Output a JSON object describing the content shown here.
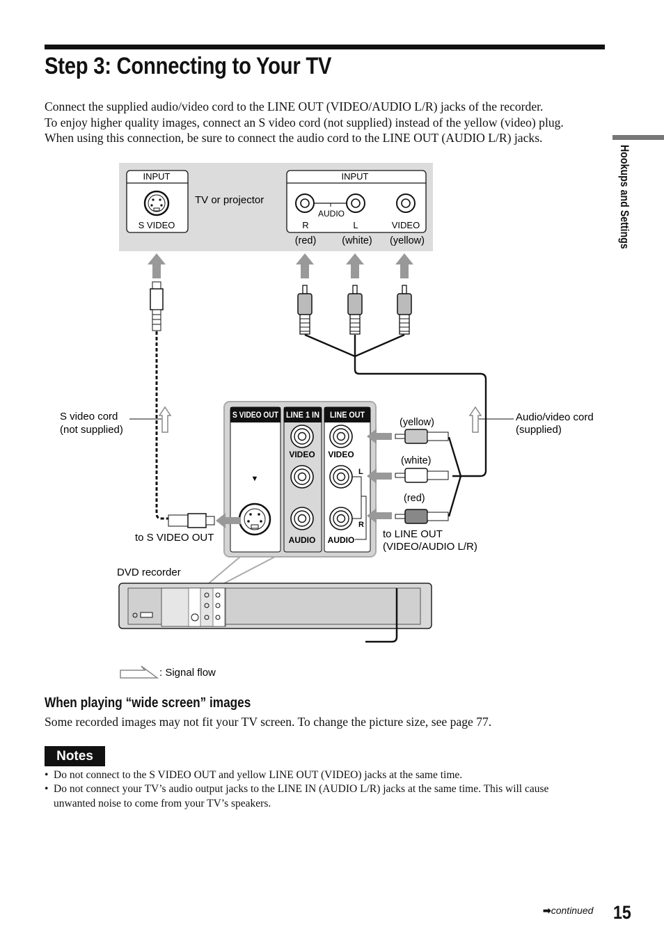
{
  "page": {
    "title": "Step 3: Connecting to Your TV",
    "intro": [
      "Connect the supplied audio/video cord to the LINE OUT (VIDEO/AUDIO L/R) jacks of the recorder.",
      "To enjoy higher quality images, connect an S video cord (not supplied) instead of the yellow (video) plug.",
      "When using this connection, be sure to connect the audio cord to the LINE OUT (AUDIO L/R) jacks."
    ],
    "side_tab": "Hookups and Settings",
    "page_number": "15",
    "continued": "continued"
  },
  "diagram": {
    "tv": {
      "label": "TV or projector",
      "svideo_box_header": "INPUT",
      "svideo_box_label": "S VIDEO",
      "av_box_header": "INPUT",
      "audio_label": "AUDIO",
      "jack_r": "R",
      "jack_l": "L",
      "jack_video": "VIDEO",
      "color_red": "(red)",
      "color_white": "(white)",
      "color_yellow": "(yellow)"
    },
    "svideo_cord": [
      "S video cord",
      "(not supplied)"
    ],
    "av_cord": [
      "Audio/video cord",
      "(supplied)"
    ],
    "panel": {
      "col_svideo_out": "S VIDEO OUT",
      "col_line1_in": "LINE 1 IN",
      "col_line_out": "LINE OUT",
      "video": "VIDEO",
      "audio": "AUDIO",
      "l": "L",
      "r": "R",
      "marker": "▼"
    },
    "plug_yellow": "(yellow)",
    "plug_white": "(white)",
    "plug_red": "(red)",
    "to_line_out": [
      "to LINE OUT",
      "(VIDEO/AUDIO L/R)"
    ],
    "to_svideo_out": "to S VIDEO OUT",
    "recorder_label": "DVD recorder",
    "legend": ": Signal flow",
    "colors": {
      "panel_grey": "#d4d4d4",
      "tv_grey": "#dcdcdc",
      "arrow_grey": "#9a9a9a"
    }
  },
  "section": {
    "heading": "When playing “wide screen” images",
    "text": "Some recorded images may not fit your TV screen. To change the picture size, see page 77."
  },
  "notes": {
    "badge": "Notes",
    "items": [
      "Do not connect to the S VIDEO OUT and yellow LINE OUT (VIDEO) jacks at the same time.",
      "Do not connect your TV’s audio output jacks to the LINE IN (AUDIO L/R) jacks at the same time. This will cause",
      "unwanted noise to come from your TV’s speakers."
    ]
  }
}
